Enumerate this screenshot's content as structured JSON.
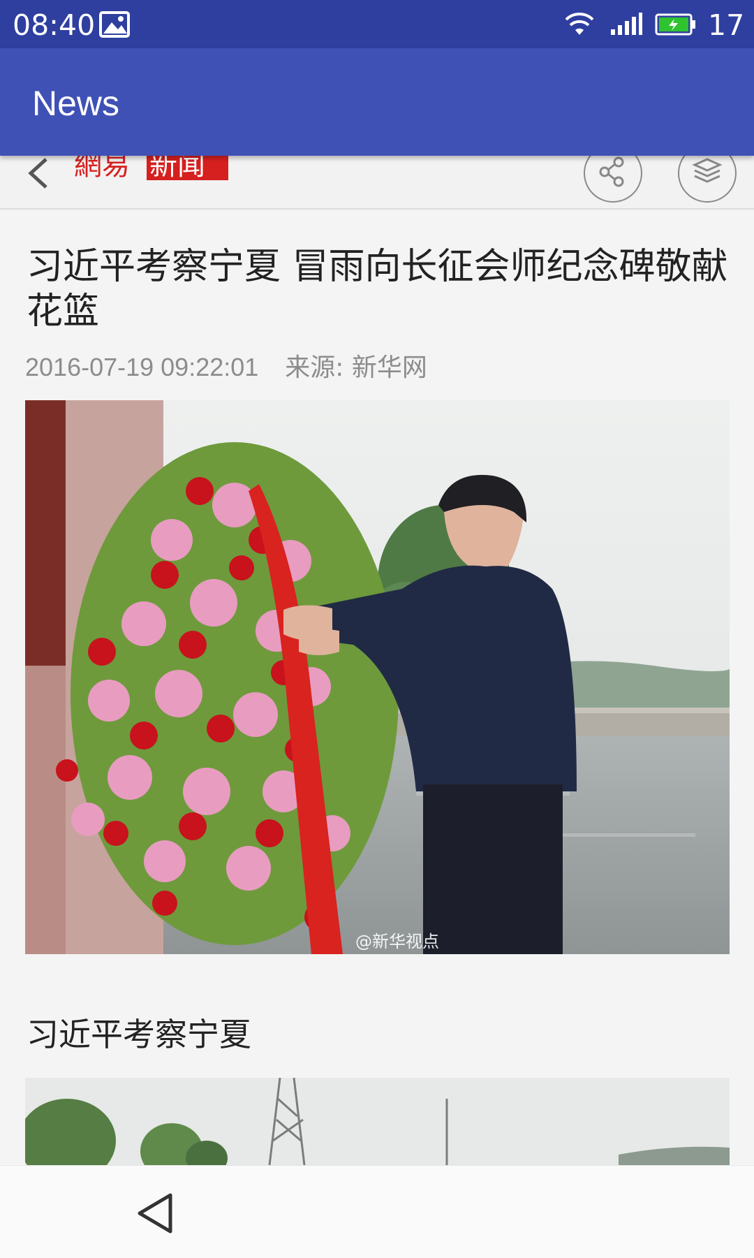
{
  "status_bar": {
    "time": "08:40",
    "battery_level": "17",
    "icons": [
      "image-icon",
      "wifi-icon",
      "signal-icon",
      "battery-icon"
    ]
  },
  "app_bar": {
    "title": "News",
    "color": "#3f51b5"
  },
  "web_header": {
    "logo_text": "網易新闻",
    "icons": [
      "back-chevron-icon",
      "share-icon",
      "layers-icon"
    ]
  },
  "article": {
    "title": "习近平考察宁夏 冒雨向长征会师纪念碑敬献花篮",
    "date": "2016-07-19 09:22:01",
    "source": "来源: 新华网",
    "photo_watermark": "@新华视点",
    "subheading": "习近平考察宁夏"
  },
  "nav_bar": {
    "icons": [
      "nav-back-icon"
    ]
  }
}
